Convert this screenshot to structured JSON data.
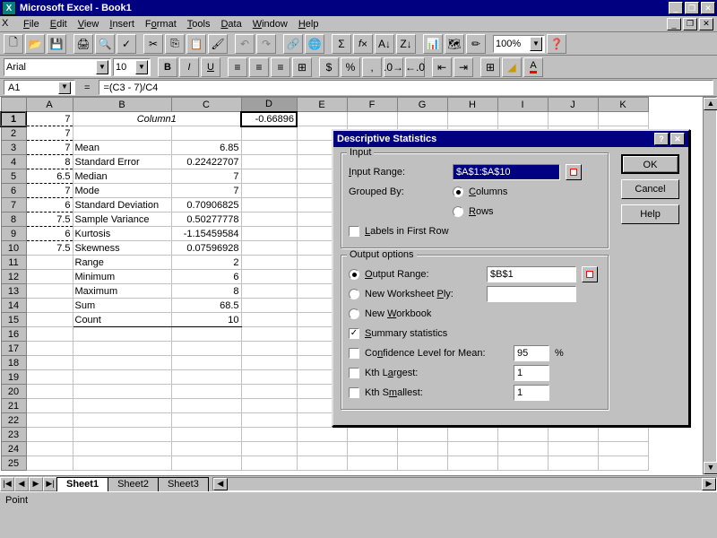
{
  "app": {
    "title": "Microsoft Excel - Book1"
  },
  "menubar": [
    "File",
    "Edit",
    "View",
    "Insert",
    "Format",
    "Tools",
    "Data",
    "Window",
    "Help"
  ],
  "font": {
    "name": "Arial",
    "size": "10"
  },
  "zoom": "100%",
  "namebox": "A1",
  "formula": "=(C3 - 7)/C4",
  "columns": [
    "A",
    "B",
    "C",
    "D",
    "E",
    "F",
    "G",
    "H",
    "I",
    "J",
    "K"
  ],
  "data_col_a": [
    "7",
    "7",
    "7",
    "8",
    "6.5",
    "7",
    "6",
    "7.5",
    "6",
    "7.5"
  ],
  "col_b_header": "Column1",
  "col_d1": "-0.66896",
  "stats": [
    {
      "label": "Mean",
      "value": "6.85"
    },
    {
      "label": "Standard Error",
      "value": "0.22422707"
    },
    {
      "label": "Median",
      "value": "7"
    },
    {
      "label": "Mode",
      "value": "7"
    },
    {
      "label": "Standard Deviation",
      "value": "0.70906825"
    },
    {
      "label": "Sample Variance",
      "value": "0.50277778"
    },
    {
      "label": "Kurtosis",
      "value": "-1.15459584"
    },
    {
      "label": "Skewness",
      "value": "0.07596928"
    },
    {
      "label": "Range",
      "value": "2"
    },
    {
      "label": "Minimum",
      "value": "6"
    },
    {
      "label": "Maximum",
      "value": "8"
    },
    {
      "label": "Sum",
      "value": "68.5"
    },
    {
      "label": "Count",
      "value": "10"
    }
  ],
  "sheet_tabs": [
    "Sheet1",
    "Sheet2",
    "Sheet3"
  ],
  "statusbar": "Point",
  "dialog": {
    "title": "Descriptive Statistics",
    "input_group": "Input",
    "input_range_label": "Input Range:",
    "input_range_value": "$A$1:$A$10",
    "grouped_by_label": "Grouped By:",
    "grouped_columns": "Columns",
    "grouped_rows": "Rows",
    "labels_first_row": "Labels in First Row",
    "output_group": "Output options",
    "output_range_label": "Output Range:",
    "output_range_value": "$B$1",
    "new_ws_ply": "New Worksheet Ply:",
    "new_wb": "New Workbook",
    "summary_stats": "Summary statistics",
    "conf_level": "Confidence Level for Mean:",
    "conf_value": "95",
    "kth_largest": "Kth Largest:",
    "kth_largest_val": "1",
    "kth_smallest": "Kth Smallest:",
    "kth_smallest_val": "1",
    "ok": "OK",
    "cancel": "Cancel",
    "help": "Help"
  }
}
